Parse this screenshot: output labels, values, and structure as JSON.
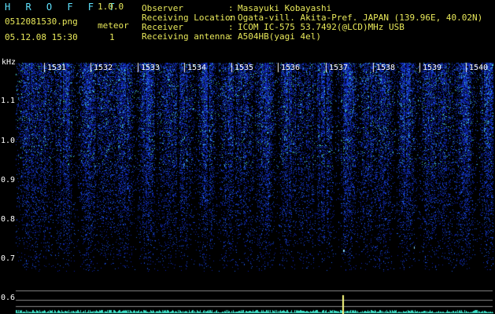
{
  "header": {
    "app_name": "H R O F F T",
    "version": "1.0.0",
    "file_name": "0512081530.png",
    "mode_label": "meteor",
    "timestamp": "05.12.08 15:30",
    "meteor_count": "1"
  },
  "station_info": [
    {
      "key": "Observer",
      "value": "Masayuki Kobayashi"
    },
    {
      "key": "Receiving Location",
      "value": "Ogata-vill. Akita-Pref. JAPAN (139.96E, 40.02N)"
    },
    {
      "key": "Receiver",
      "value": "ICOM IC-575 53.7492(@LCD)MHz USB"
    },
    {
      "key": "Receiving antenna",
      "value": "A504HB(yagi 4el)"
    }
  ],
  "spectrogram": {
    "y_unit": "kHz",
    "y_ticks": [
      "1.1",
      "1.0",
      "0.9",
      "0.8",
      "0.7",
      "0.6"
    ],
    "minute_markers": [
      "1531",
      "1532",
      "1533",
      "1534",
      "1535",
      "1536",
      "1537",
      "1538",
      "1539",
      "1540"
    ],
    "colors": {
      "background": "#000000",
      "noise_low": "#0a1a8c",
      "noise_high": "#3fd0d0",
      "marker": "#ffff80",
      "baseline": "#3fe0c8"
    }
  }
}
